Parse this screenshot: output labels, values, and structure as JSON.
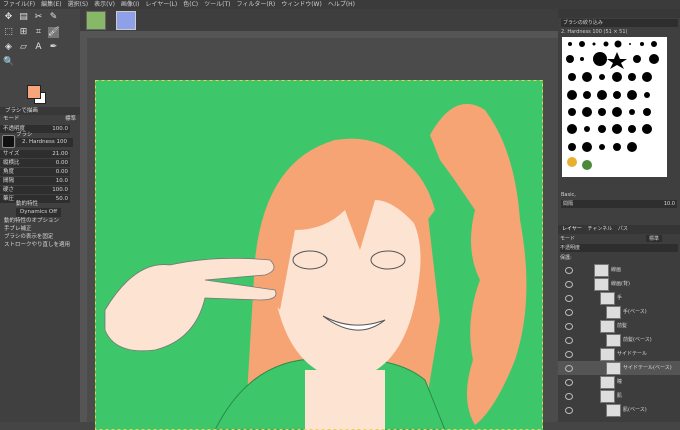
{
  "menu": [
    "ファイル(F)",
    "編集(E)",
    "選択(S)",
    "表示(V)",
    "画像(I)",
    "レイヤー(L)",
    "色(C)",
    "ツール(T)",
    "フィルター(R)",
    "ウィンドウ(W)",
    "ヘルプ(H)"
  ],
  "tool_options": {
    "title": "ブラシで描画",
    "mode_label": "モード",
    "mode_value": "標準",
    "opacity_label": "不透明度",
    "opacity_value": "100.0",
    "brush_label": "ブラシ",
    "brush_value": "2. Hardness 100",
    "size_label": "サイズ",
    "size_value": "21.00",
    "aspect_label": "縦横比",
    "aspect_value": "0.00",
    "angle_label": "角度",
    "angle_value": "0.00",
    "spacing_label": "間隔",
    "spacing_value": "10.0",
    "hardness_label": "硬さ",
    "hardness_value": "100.0",
    "force_label": "筆圧",
    "force_value": "50.0",
    "dynamics_label": "動的特性",
    "dynamics_value": "Dynamics Off",
    "dynamics_options": "動的特性のオプション",
    "opt1": "手ブレ補正",
    "opt2": "ブラシの表示を固定",
    "opt3": "ストロークやり直しを適用"
  },
  "brushes": {
    "filter_label": "ブラシの絞り込み",
    "current": "2. Hardness 100 (51 × 51)",
    "preset_label": "Basic,",
    "spacing_label": "間隔",
    "spacing_value": "10.0"
  },
  "layers": {
    "tabs": [
      "レイヤー",
      "チャンネル",
      "パス"
    ],
    "mode_label": "モード",
    "mode_value": "標準",
    "opacity_label": "不透明度",
    "lock_label": "保護:",
    "items": [
      {
        "name": "線画"
      },
      {
        "name": "線画(背)"
      },
      {
        "name": "手"
      },
      {
        "name": "手(ベース)"
      },
      {
        "name": "前髪"
      },
      {
        "name": "前髪(ベース)"
      },
      {
        "name": "サイドテール"
      },
      {
        "name": "サイドテール(ベース)"
      },
      {
        "name": "瞳"
      },
      {
        "name": "肌"
      },
      {
        "name": "肌(ベース)"
      }
    ]
  },
  "colors": {
    "canvas_bg": "#3ec76a",
    "skin": "#fde3d2",
    "hair": "#f6a474",
    "foreground": "#f7a57a",
    "background": "#ffffff"
  }
}
